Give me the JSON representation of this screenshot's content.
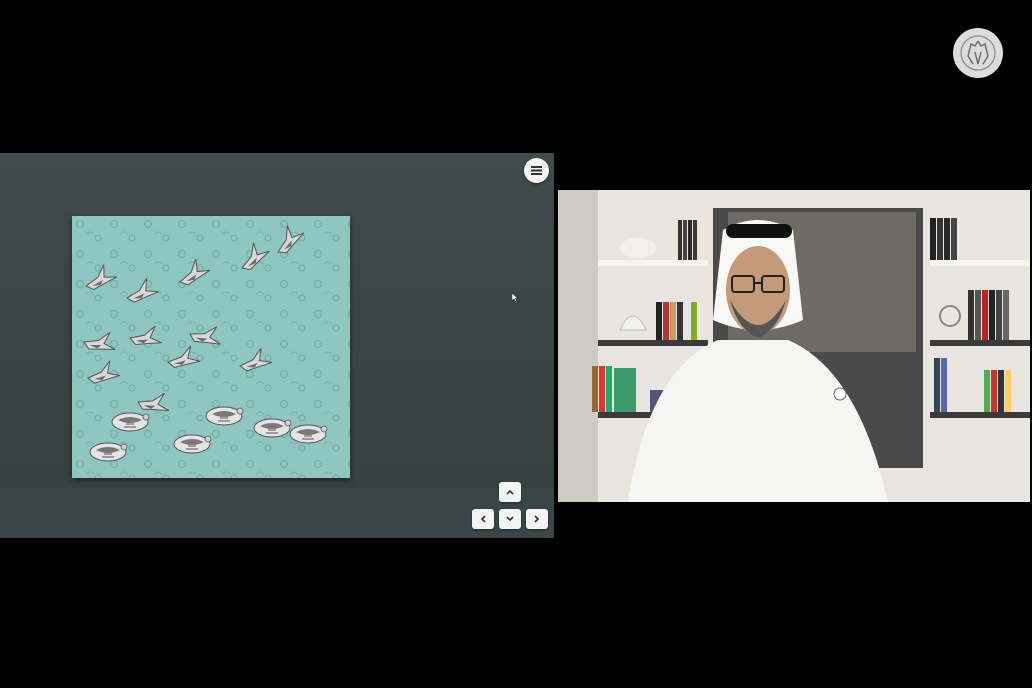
{
  "logo": {
    "icon": "falcon-emblem-icon"
  },
  "share_panel": {
    "menu_button_icon": "hamburger-menu-icon",
    "artwork_subject": "painting",
    "navigation": {
      "up_icon": "chevron-up-icon",
      "left_icon": "chevron-left-icon",
      "down_icon": "chevron-down-icon",
      "right_icon": "chevron-right-icon"
    }
  },
  "video_panel": {
    "participant_icon": "video-feed"
  },
  "colors": {
    "background": "#000000",
    "share_panel": "#3a4647",
    "painting_bg": "#8fc6c1",
    "button_bg": "#f4f4f4",
    "logo_bg": "#dcdcdc"
  }
}
